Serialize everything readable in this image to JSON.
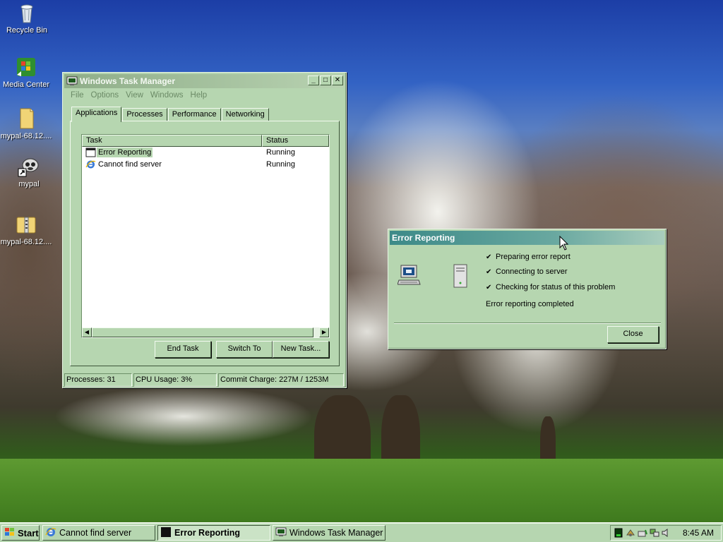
{
  "desktop": {
    "icons": [
      {
        "label": "Recycle Bin",
        "icon": "recycle-bin-icon"
      },
      {
        "label": "Media Center",
        "icon": "media-center-icon"
      },
      {
        "label": "mypal-68.12....",
        "icon": "folder-icon"
      },
      {
        "label": "mypal",
        "icon": "mypal-shortcut-icon"
      },
      {
        "label": "mypal-68.12....",
        "icon": "zip-folder-icon"
      }
    ]
  },
  "task_manager": {
    "title": "Windows Task Manager",
    "menu": [
      "File",
      "Options",
      "View",
      "Windows",
      "Help"
    ],
    "tabs": [
      "Applications",
      "Processes",
      "Performance",
      "Networking"
    ],
    "active_tab": "Applications",
    "columns": [
      "Task",
      "Status"
    ],
    "rows": [
      {
        "task": "Error Reporting",
        "status": "Running",
        "selected": true
      },
      {
        "task": "Cannot find server",
        "status": "Running",
        "selected": false
      }
    ],
    "buttons": {
      "end_task": "End Task",
      "switch_to": "Switch To",
      "new_task": "New Task..."
    },
    "status": {
      "processes": "Processes: 31",
      "cpu": "CPU Usage: 3%",
      "commit": "Commit Charge: 227M / 1253M"
    }
  },
  "error_reporting": {
    "title": "Error Reporting",
    "steps": [
      "Preparing error report",
      "Connecting to server",
      "Checking for status of this problem"
    ],
    "completed": "Error reporting completed",
    "close_label": "Close"
  },
  "taskbar": {
    "start_label": "Start",
    "items": [
      {
        "label": "Cannot find server",
        "pressed": false
      },
      {
        "label": "Error Reporting",
        "pressed": true
      },
      {
        "label": "Windows Task Manager",
        "pressed": false
      }
    ],
    "clock": "8:45 AM"
  },
  "colors": {
    "window_face": "#b6d6b0",
    "error_titlebar": "#3d8a88",
    "tm_titlebar": "#8fae89"
  }
}
